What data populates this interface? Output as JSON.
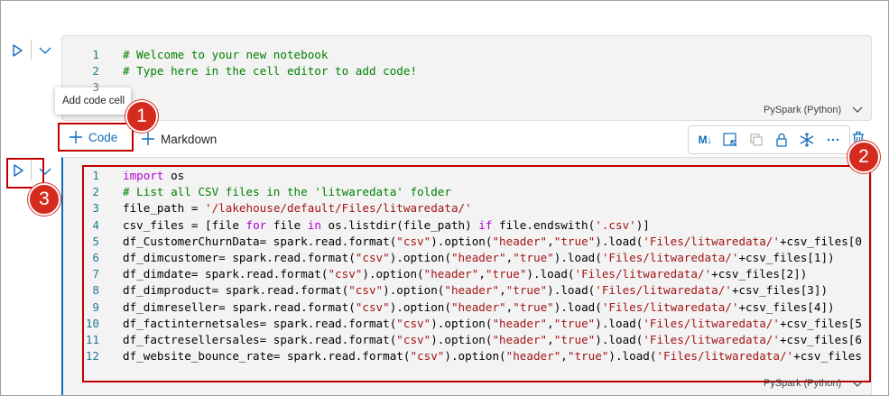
{
  "cell1": {
    "language": "PySpark (Python)",
    "lines": [
      {
        "n": "1",
        "tokens": [
          {
            "t": "# Welcome to your new notebook",
            "c": "comment"
          }
        ]
      },
      {
        "n": "2",
        "tokens": [
          {
            "t": "# Type here in the cell editor to add code!",
            "c": "comment"
          }
        ]
      },
      {
        "n": "3",
        "tokens": []
      }
    ]
  },
  "tooltip": "Add code cell",
  "add_bar": {
    "code_label": "Code",
    "markdown_label": "Markdown"
  },
  "toolbar": {
    "markdown_toggle": "M↓"
  },
  "cell2": {
    "language": "PySpark (Python)",
    "lines": [
      {
        "n": "1",
        "tokens": [
          {
            "t": "import",
            "c": "kw2"
          },
          {
            "t": " os",
            "c": "plain"
          }
        ]
      },
      {
        "n": "2",
        "tokens": [
          {
            "t": "# List all CSV files in the 'litwaredata' folder",
            "c": "comment"
          }
        ]
      },
      {
        "n": "3",
        "tokens": [
          {
            "t": "file_path = ",
            "c": "plain"
          },
          {
            "t": "'/lakehouse/default/Files/litwaredata/'",
            "c": "str"
          }
        ]
      },
      {
        "n": "4",
        "tokens": [
          {
            "t": "csv_files = [file ",
            "c": "plain"
          },
          {
            "t": "for",
            "c": "kw2"
          },
          {
            "t": " file ",
            "c": "plain"
          },
          {
            "t": "in",
            "c": "kw2"
          },
          {
            "t": " os.listdir(file_path) ",
            "c": "plain"
          },
          {
            "t": "if",
            "c": "kw2"
          },
          {
            "t": " file.endswith(",
            "c": "plain"
          },
          {
            "t": "'.csv'",
            "c": "str"
          },
          {
            "t": ")]",
            "c": "plain"
          }
        ]
      },
      {
        "n": "5",
        "tokens": [
          {
            "t": "df_CustomerChurnData= spark.read.format(",
            "c": "plain"
          },
          {
            "t": "\"csv\"",
            "c": "str"
          },
          {
            "t": ").option(",
            "c": "plain"
          },
          {
            "t": "\"header\"",
            "c": "str"
          },
          {
            "t": ",",
            "c": "plain"
          },
          {
            "t": "\"true\"",
            "c": "str"
          },
          {
            "t": ").load(",
            "c": "plain"
          },
          {
            "t": "'Files/litwaredata/'",
            "c": "str"
          },
          {
            "t": "+csv_files[0",
            "c": "plain"
          }
        ]
      },
      {
        "n": "6",
        "tokens": [
          {
            "t": "df_dimcustomer= spark.read.format(",
            "c": "plain"
          },
          {
            "t": "\"csv\"",
            "c": "str"
          },
          {
            "t": ").option(",
            "c": "plain"
          },
          {
            "t": "\"header\"",
            "c": "str"
          },
          {
            "t": ",",
            "c": "plain"
          },
          {
            "t": "\"true\"",
            "c": "str"
          },
          {
            "t": ").load(",
            "c": "plain"
          },
          {
            "t": "'Files/litwaredata/'",
            "c": "str"
          },
          {
            "t": "+csv_files[1])",
            "c": "plain"
          }
        ]
      },
      {
        "n": "7",
        "tokens": [
          {
            "t": "df_dimdate= spark.read.format(",
            "c": "plain"
          },
          {
            "t": "\"csv\"",
            "c": "str"
          },
          {
            "t": ").option(",
            "c": "plain"
          },
          {
            "t": "\"header\"",
            "c": "str"
          },
          {
            "t": ",",
            "c": "plain"
          },
          {
            "t": "\"true\"",
            "c": "str"
          },
          {
            "t": ").load(",
            "c": "plain"
          },
          {
            "t": "'Files/litwaredata/'",
            "c": "str"
          },
          {
            "t": "+csv_files[2])",
            "c": "plain"
          }
        ]
      },
      {
        "n": "8",
        "tokens": [
          {
            "t": "df_dimproduct= spark.read.format(",
            "c": "plain"
          },
          {
            "t": "\"csv\"",
            "c": "str"
          },
          {
            "t": ").option(",
            "c": "plain"
          },
          {
            "t": "\"header\"",
            "c": "str"
          },
          {
            "t": ",",
            "c": "plain"
          },
          {
            "t": "\"true\"",
            "c": "str"
          },
          {
            "t": ").load(",
            "c": "plain"
          },
          {
            "t": "'Files/litwaredata/'",
            "c": "str"
          },
          {
            "t": "+csv_files[3])",
            "c": "plain"
          }
        ]
      },
      {
        "n": "9",
        "tokens": [
          {
            "t": "df_dimreseller= spark.read.format(",
            "c": "plain"
          },
          {
            "t": "\"csv\"",
            "c": "str"
          },
          {
            "t": ").option(",
            "c": "plain"
          },
          {
            "t": "\"header\"",
            "c": "str"
          },
          {
            "t": ",",
            "c": "plain"
          },
          {
            "t": "\"true\"",
            "c": "str"
          },
          {
            "t": ").load(",
            "c": "plain"
          },
          {
            "t": "'Files/litwaredata/'",
            "c": "str"
          },
          {
            "t": "+csv_files[4])",
            "c": "plain"
          }
        ]
      },
      {
        "n": "10",
        "tokens": [
          {
            "t": "df_factinternetsales= spark.read.format(",
            "c": "plain"
          },
          {
            "t": "\"csv\"",
            "c": "str"
          },
          {
            "t": ").option(",
            "c": "plain"
          },
          {
            "t": "\"header\"",
            "c": "str"
          },
          {
            "t": ",",
            "c": "plain"
          },
          {
            "t": "\"true\"",
            "c": "str"
          },
          {
            "t": ").load(",
            "c": "plain"
          },
          {
            "t": "'Files/litwaredata/'",
            "c": "str"
          },
          {
            "t": "+csv_files[5",
            "c": "plain"
          }
        ]
      },
      {
        "n": "11",
        "tokens": [
          {
            "t": "df_factresellersales= spark.read.format(",
            "c": "plain"
          },
          {
            "t": "\"csv\"",
            "c": "str"
          },
          {
            "t": ").option(",
            "c": "plain"
          },
          {
            "t": "\"header\"",
            "c": "str"
          },
          {
            "t": ",",
            "c": "plain"
          },
          {
            "t": "\"true\"",
            "c": "str"
          },
          {
            "t": ").load(",
            "c": "plain"
          },
          {
            "t": "'Files/litwaredata/'",
            "c": "str"
          },
          {
            "t": "+csv_files[6",
            "c": "plain"
          }
        ]
      },
      {
        "n": "12",
        "tokens": [
          {
            "t": "df_website_bounce_rate= spark.read.format(",
            "c": "plain"
          },
          {
            "t": "\"csv\"",
            "c": "str"
          },
          {
            "t": ").option(",
            "c": "plain"
          },
          {
            "t": "\"header\"",
            "c": "str"
          },
          {
            "t": ",",
            "c": "plain"
          },
          {
            "t": "\"true\"",
            "c": "str"
          },
          {
            "t": ").load(",
            "c": "plain"
          },
          {
            "t": "'Files/litwaredata/'",
            "c": "str"
          },
          {
            "t": "+csv_files",
            "c": "plain"
          }
        ]
      }
    ]
  },
  "badges": [
    "1",
    "2",
    "3"
  ],
  "colors": {
    "accent": "#0f6cbd",
    "highlight": "#c00000",
    "badge": "#d42b1e",
    "comment": "#008000",
    "string": "#a31515",
    "keyword": "#af00db"
  }
}
